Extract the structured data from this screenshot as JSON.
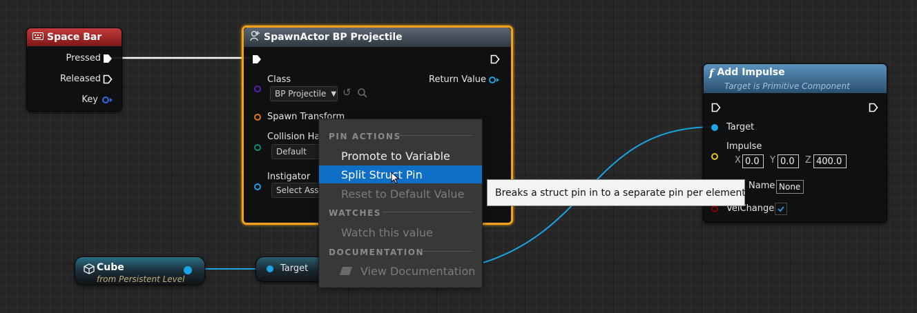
{
  "graph": {
    "wire_colors": {
      "exec": "#ffffff",
      "object": "#1aa4e4"
    }
  },
  "space_bar_node": {
    "title": "Space Bar",
    "header_color": "#a42424",
    "icon": "keyboard-icon",
    "pins": {
      "pressed": "Pressed",
      "released": "Released",
      "key": "Key"
    }
  },
  "spawn_actor_node": {
    "title": "SpawnActor BP Projectile",
    "icon": "spawn-actor-icon",
    "selected_outline_color": "#f2a31b",
    "pins": {
      "class_label": "Class",
      "class_value": "BP Projectile",
      "spawn_transform": "Spawn Transform",
      "collision": "Collision Han",
      "collision_value": "Default",
      "instigator": "Instigator",
      "instigator_value": "Select Asset",
      "return_value": "Return Value"
    }
  },
  "add_impulse_node": {
    "title": "Add Impulse",
    "subtitle": "Target is Primitive Component",
    "icon": "function-icon",
    "header_color": "#4a7ea8",
    "pins": {
      "target": "Target",
      "impulse": "Impulse",
      "x_label": "X",
      "x_value": "0.0",
      "y_label": "Y",
      "y_value": "0.0",
      "z_label": "Z",
      "z_value": "400.0",
      "bone_name_label": "Name",
      "bone_name_value": "None",
      "vel_change_label": "VelChange",
      "vel_change_checked": true
    }
  },
  "cube_node": {
    "title": "Cube",
    "subtitle": "from Persistent Level",
    "icon": "cube-icon"
  },
  "target_reroute": {
    "label": "Target"
  },
  "context_menu": {
    "sections": {
      "pin_actions": "PIN ACTIONS",
      "watches": "WATCHES",
      "documentation": "DOCUMENTATION"
    },
    "items": {
      "promote": "Promote to Variable",
      "split": "Split Struct Pin",
      "reset": "Reset to Default Value",
      "watch": "Watch this value",
      "view_docs": "View Documentation"
    },
    "selected_item": "Split Struct Pin"
  },
  "tooltip": {
    "text": "Breaks a struct pin in to a separate pin per element"
  }
}
